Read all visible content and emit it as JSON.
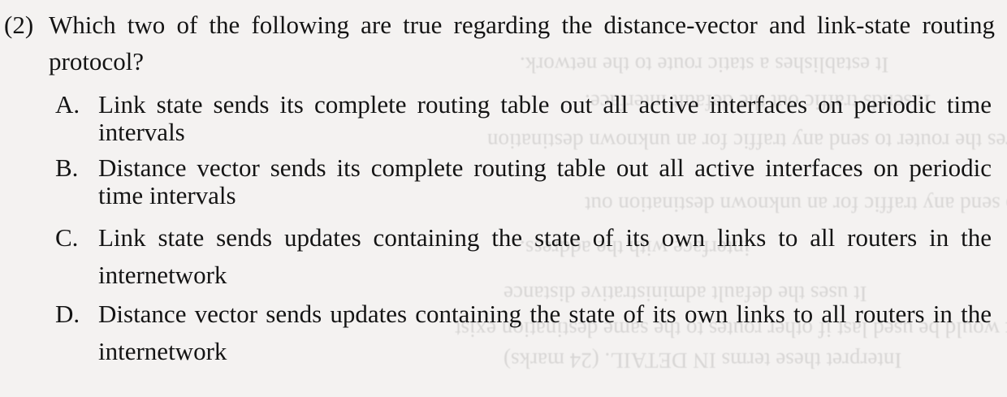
{
  "question": {
    "number": "(2)",
    "text": "Which two of the following are true regarding the distance-vector and link-state routing protocol?",
    "options": [
      {
        "letter": "A.",
        "text": "Link state sends its complete routing table out all active interfaces on periodic time intervals"
      },
      {
        "letter": "B.",
        "text": "Distance vector sends its complete routing table out all active interfaces on periodic time intervals"
      },
      {
        "letter": "C.",
        "text": "Link state sends updates containing the state of its own links to all routers in the internetwork"
      },
      {
        "letter": "D.",
        "text": "Distance vector sends updates containing the state of its own links to all routers in the internetwork"
      }
    ]
  }
}
